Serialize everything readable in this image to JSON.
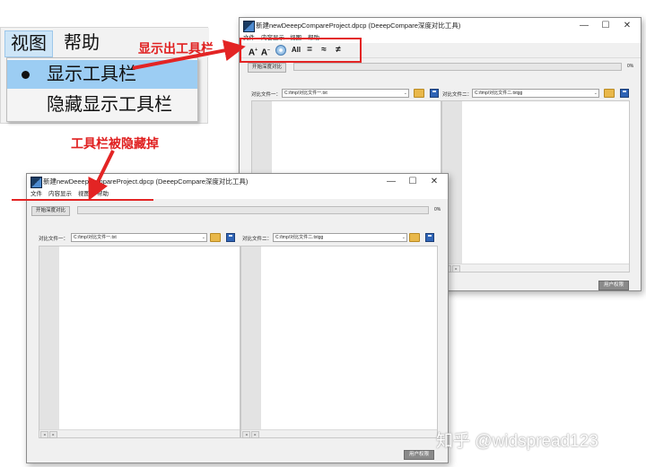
{
  "menu_zoom": {
    "menubar": [
      "视图",
      "帮助"
    ],
    "items": [
      {
        "label": "显示工具栏",
        "checked": true
      },
      {
        "label": "隐藏显示工具栏",
        "checked": false
      }
    ]
  },
  "annotations": {
    "show_toolbar": "显示出工具栏",
    "hidden_toolbar": "工具栏被隐藏掉",
    "color": "#e32424"
  },
  "window_top": {
    "title": "新建newDeeepCompareProject.dpcp (DeeepCompare深度对比工具)",
    "controls": [
      "—",
      "☐",
      "✕"
    ],
    "menu": [
      "文件",
      "内容显示",
      "视图",
      "帮助"
    ],
    "toolbar": {
      "font_increase": "A",
      "font_decrease": "A",
      "buttons": [
        "All",
        "=",
        "≈",
        "≠"
      ]
    },
    "compare_button": "开始深度对比",
    "progress_text": "0%",
    "left_label": "对比文件一：",
    "left_path": "C:/tmp/对比文件一.txt",
    "right_label": "对比文件二：",
    "right_path": "C:/tmp/对比文件二.txtgg",
    "status_button": "用户权限"
  },
  "window_bottom": {
    "title": "新建newDeeepCompareProject.dpcp (DeeepCompare深度对比工具)",
    "controls": [
      "—",
      "☐",
      "✕"
    ],
    "menu": [
      "文件",
      "内容显示",
      "视图",
      "帮助"
    ],
    "compare_button": "开始深度对比",
    "progress_text": "0%",
    "left_label": "对比文件一：",
    "left_path": "C:/tmp/对比文件一.txt",
    "right_label": "对比文件二：",
    "right_path": "C:/tmp/对比文件二.txtgg",
    "status_button": "用户权限"
  },
  "watermark": "知乎 @widspread123"
}
